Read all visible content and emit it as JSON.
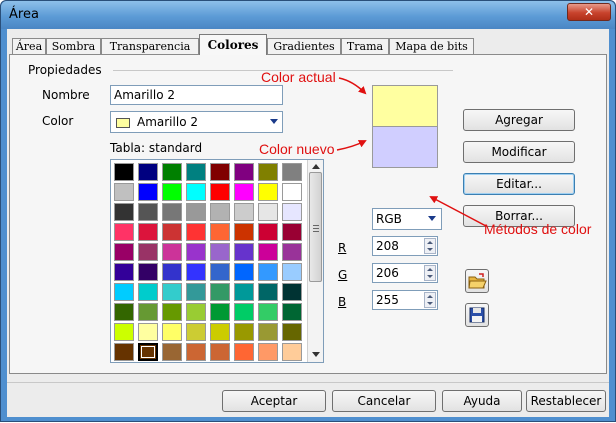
{
  "window": {
    "title": "Área",
    "close_glyph": "✕"
  },
  "tabs": [
    {
      "label": "Área",
      "active": false
    },
    {
      "label": "Sombra",
      "active": false
    },
    {
      "label": "Transparencia",
      "active": false
    },
    {
      "label": "Colores",
      "active": true
    },
    {
      "label": "Gradientes",
      "active": false
    },
    {
      "label": "Trama",
      "active": false
    },
    {
      "label": "Mapa de bits",
      "active": false
    }
  ],
  "properties": {
    "group_label": "Propiedades",
    "name_label": "Nombre",
    "name_value": "Amarillo 2",
    "color_label": "Color",
    "color_value": "Amarillo 2",
    "color_value_hex": "#ffffa0",
    "table_label": "Tabla: standard"
  },
  "palette": {
    "selected_index": 73,
    "colors": [
      "#000000",
      "#000080",
      "#008000",
      "#008080",
      "#800000",
      "#800080",
      "#808000",
      "#808080",
      "#c0c0c0",
      "#0000ff",
      "#00ff00",
      "#00ffff",
      "#ff0000",
      "#ff00ff",
      "#ffff00",
      "#ffffff",
      "#333333",
      "#555555",
      "#777777",
      "#999999",
      "#b2b2b2",
      "#cccccc",
      "#e6e6e6",
      "#e6e6ff",
      "#ff3366",
      "#dc143c",
      "#cc3333",
      "#ff3333",
      "#ff6633",
      "#cc3300",
      "#cc0033",
      "#990033",
      "#990066",
      "#993366",
      "#cc3399",
      "#9933cc",
      "#9966cc",
      "#6633cc",
      "#cc0099",
      "#993399",
      "#330099",
      "#330066",
      "#3333cc",
      "#3333ff",
      "#3366cc",
      "#0066ff",
      "#3399ff",
      "#99ccff",
      "#00ccff",
      "#00cccc",
      "#33cccc",
      "#339999",
      "#339966",
      "#009999",
      "#006666",
      "#003333",
      "#336600",
      "#669933",
      "#669900",
      "#99cc33",
      "#009933",
      "#00cc66",
      "#33cc66",
      "#006633",
      "#ccff00",
      "#ffffa0",
      "#ffff66",
      "#cccc33",
      "#cccc00",
      "#999900",
      "#999933",
      "#666600",
      "#663300",
      "#663300",
      "#996633",
      "#cc6633",
      "#cc6633",
      "#ff6633",
      "#ff9966",
      "#ffcc99"
    ]
  },
  "preview": {
    "current_hex": "#ffffa0",
    "new_hex": "#d0ceff"
  },
  "color_model": {
    "model": "RGB",
    "channels": [
      {
        "label": "R",
        "value": "208"
      },
      {
        "label": "G",
        "value": "206"
      },
      {
        "label": "B",
        "value": "255"
      }
    ]
  },
  "buttons": {
    "add": "Agregar",
    "modify": "Modificar",
    "edit": "Editar...",
    "delete": "Borrar..."
  },
  "footer": {
    "ok": "Aceptar",
    "cancel": "Cancelar",
    "help": "Ayuda",
    "reset": "Restablecer"
  },
  "annotations": {
    "current": "Color actual",
    "new": "Color nuevo",
    "methods": "Métodos de color",
    "color": "#e01010"
  },
  "icons": {
    "load": "folder-open-icon",
    "save": "floppy-disk-icon"
  }
}
